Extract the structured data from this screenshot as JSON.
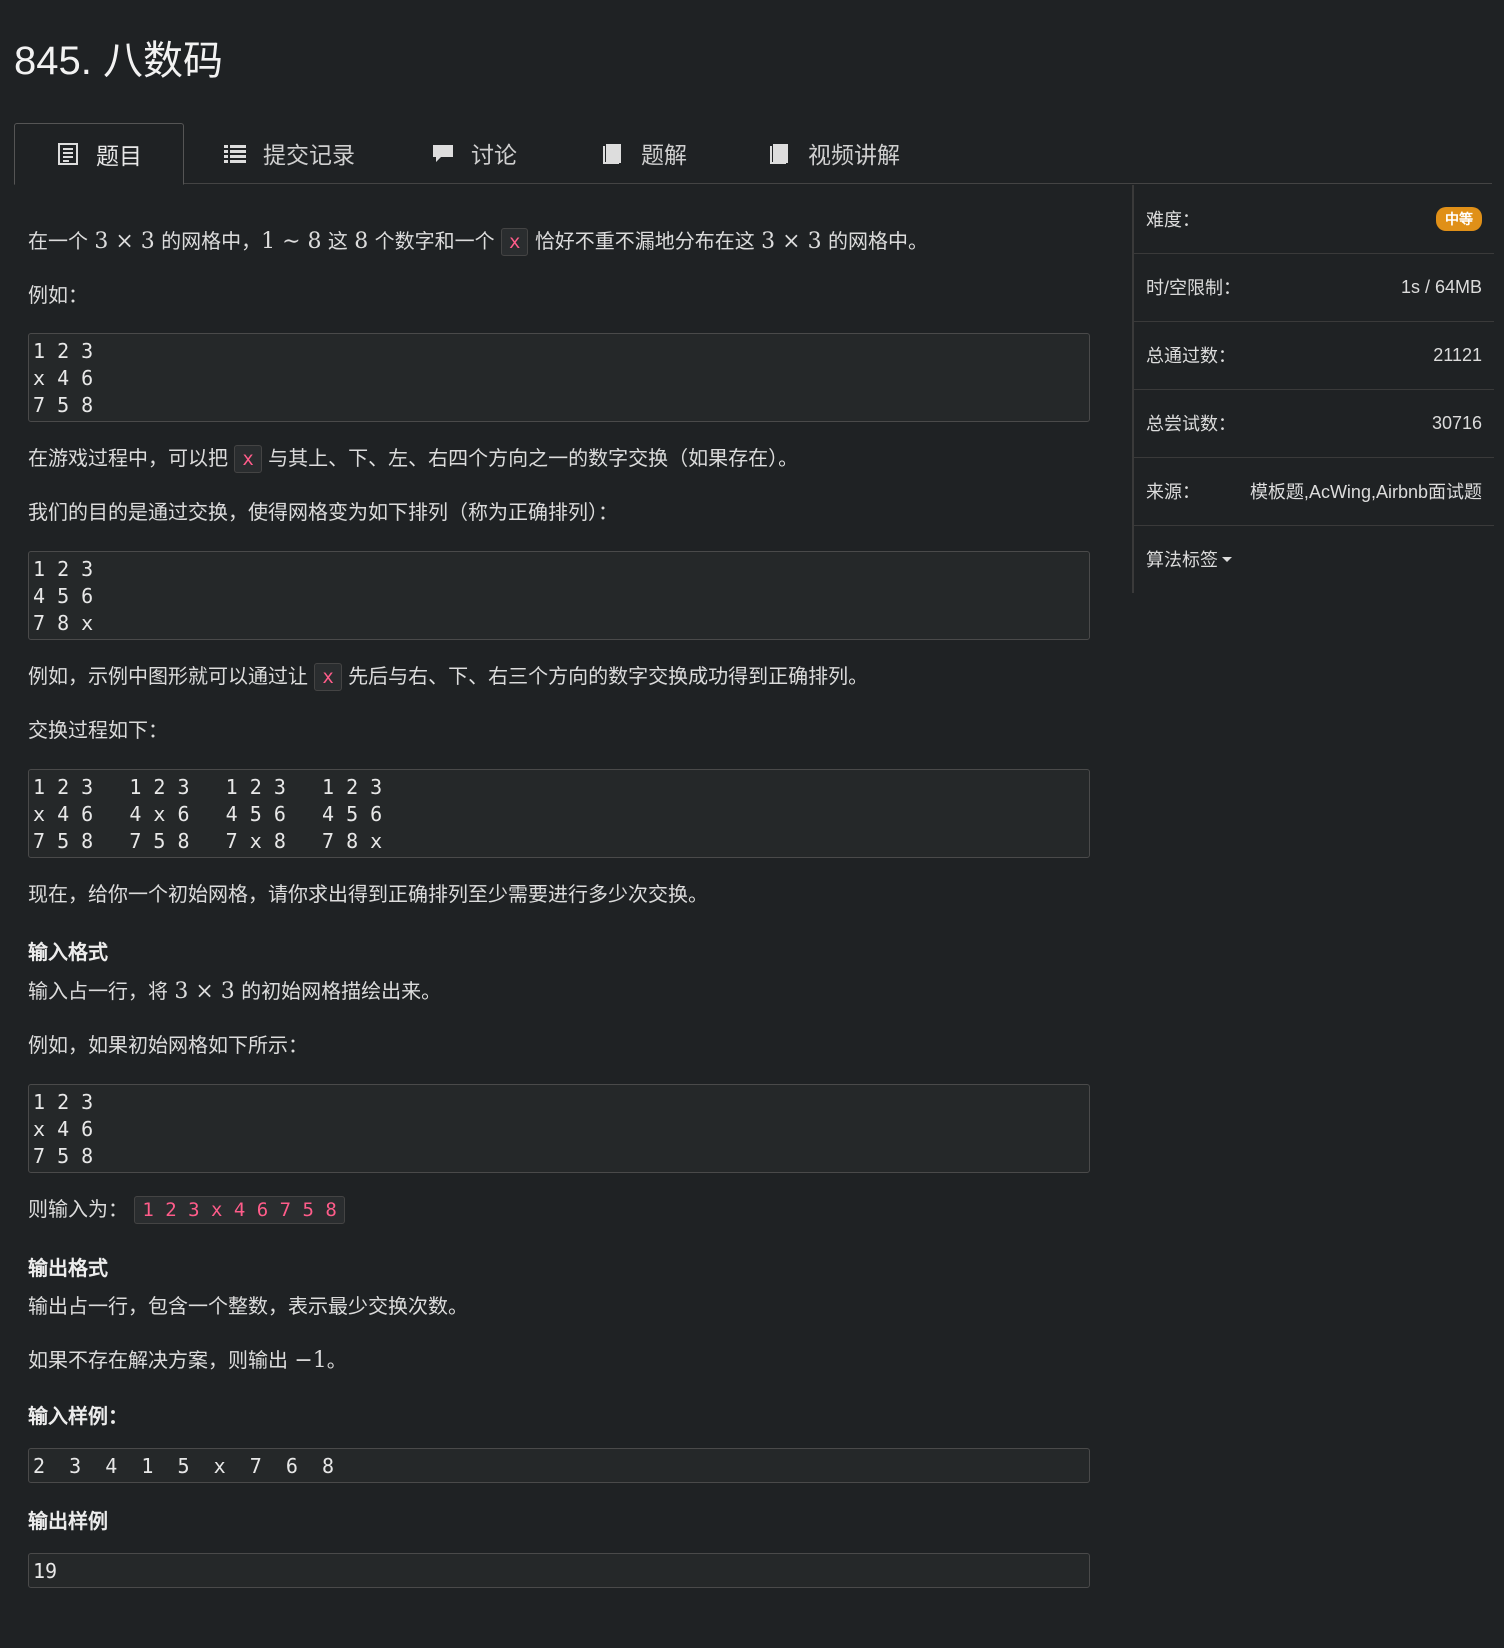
{
  "title": "845. 八数码",
  "tabs": [
    {
      "label": "题目",
      "icon": "document-icon"
    },
    {
      "label": "提交记录",
      "icon": "list-icon"
    },
    {
      "label": "讨论",
      "icon": "comment-icon"
    },
    {
      "label": "题解",
      "icon": "book-icon"
    },
    {
      "label": "视频讲解",
      "icon": "book-icon"
    }
  ],
  "problem": {
    "intro_a": "在一个",
    "intro_math1": "3 × 3",
    "intro_b": "的网格中，",
    "intro_math2": "1 ∼ 8",
    "intro_c": "这",
    "intro_math3": "8",
    "intro_d": "个数字和一个",
    "x": "x",
    "intro_e": "恰好不重不漏地分布在这",
    "intro_math4": "3 × 3",
    "intro_f": "的网格中。",
    "example_label": "例如：",
    "grid1": "1 2 3\nx 4 6\n7 5 8",
    "swap_a": "在游戏过程中，可以把",
    "swap_b": "与其上、下、左、右四个方向之一的数字交换（如果存在）。",
    "goal": "我们的目的是通过交换，使得网格变为如下排列（称为正确排列）：",
    "grid2": "1 2 3\n4 5 6\n7 8 x",
    "ex_a": "例如，示例中图形就可以通过让",
    "ex_b": "先后与右、下、右三个方向的数字交换成功得到正确排列。",
    "process_label": "交换过程如下：",
    "grid3": "1 2 3   1 2 3   1 2 3   1 2 3\nx 4 6   4 x 6   4 5 6   4 5 6\n7 5 8   7 5 8   7 x 8   7 8 x",
    "question": "现在，给你一个初始网格，请你求出得到正确排列至少需要进行多少次交换。",
    "input_heading": "输入格式",
    "input_a": "输入占一行，将",
    "input_math": "3 × 3",
    "input_b": "的初始网格描绘出来。",
    "input_example": "例如，如果初始网格如下所示：",
    "grid4": "1 2 3\nx 4 6\n7 5 8",
    "input_is": "则输入为：",
    "input_inline": "1 2 3 x 4 6 7 5 8",
    "output_heading": "输出格式",
    "output_a": "输出占一行，包含一个整数，表示最少交换次数。",
    "output_b": "如果不存在解决方案，则输出",
    "output_math": "−1",
    "output_c": "。",
    "sample_in_heading": "输入样例：",
    "sample_in": "2  3  4  1  5  x  7  6  8",
    "sample_out_heading": "输出样例",
    "sample_out": "19"
  },
  "sidebar": {
    "difficulty_label": "难度：",
    "difficulty_value": "中等",
    "difficulty_color": "#e09018",
    "limit_label": "时/空限制：",
    "limit_value": "1s / 64MB",
    "passed_label": "总通过数：",
    "passed_value": "21121",
    "tried_label": "总尝试数：",
    "tried_value": "30716",
    "source_label": "来源：",
    "source_value": "模板题,AcWing,Airbnb面试题",
    "tags_label": "算法标签"
  }
}
